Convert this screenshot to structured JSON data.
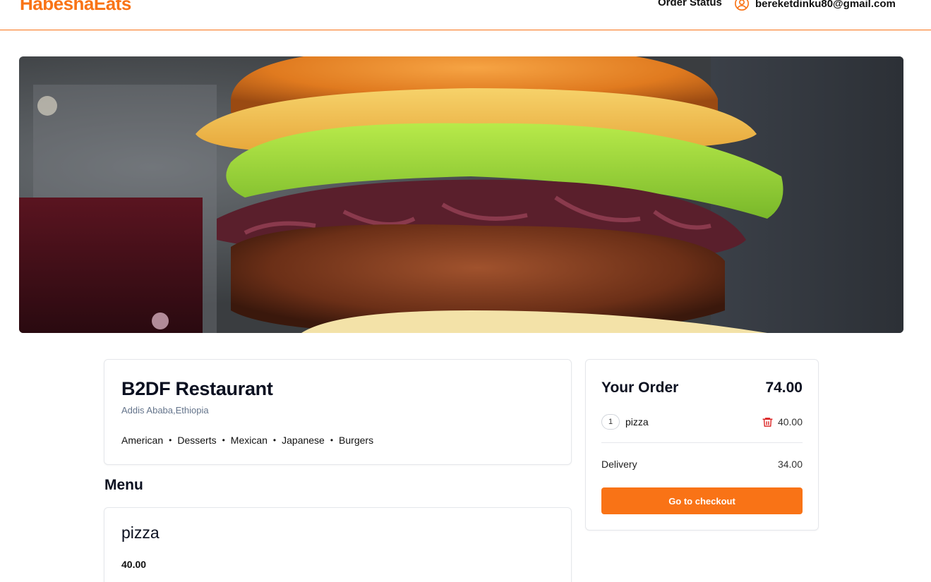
{
  "header": {
    "logo": "HabeshaEats",
    "order_status_label": "Order Status",
    "user_email": "bereketdinku80@gmail.com"
  },
  "hero": {
    "image_name": "burger-hero-image"
  },
  "restaurant": {
    "name": "B2DF Restaurant",
    "location": "Addis Ababa,Ethiopia",
    "cuisines": [
      "American",
      "Desserts",
      "Mexican",
      "Japanese",
      "Burgers"
    ]
  },
  "menu": {
    "title": "Menu",
    "items": [
      {
        "name": "pizza",
        "price": "40.00"
      }
    ]
  },
  "order": {
    "title": "Your Order",
    "total": "74.00",
    "lines": [
      {
        "qty": "1",
        "name": "pizza",
        "price": "40.00"
      }
    ],
    "delivery_label": "Delivery",
    "delivery_value": "34.00",
    "checkout_label": "Go to checkout"
  },
  "colors": {
    "brand": "#f97316",
    "delete": "#dc2626"
  },
  "icons": {
    "user": "user-circle-icon",
    "delete": "trash-icon"
  }
}
